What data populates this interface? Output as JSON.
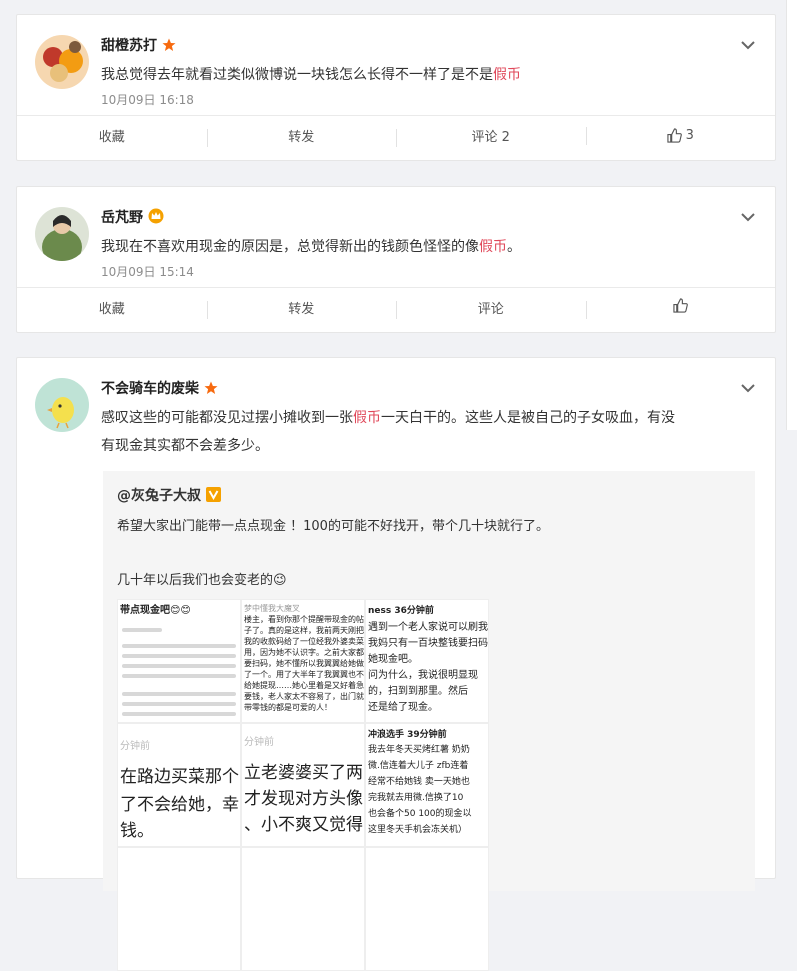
{
  "posts": [
    {
      "username": "甜橙苏打",
      "content_before": "我总觉得去年就看过类似微博说一块钱怎么长得不一样了是不是",
      "content_highlight": "假币",
      "content_after": "",
      "time": "10月09日 16:18",
      "actions": {
        "favorite": "收藏",
        "repost": "转发",
        "comment": "评论 2",
        "like_count": "3"
      }
    },
    {
      "username": "岳芃野",
      "content_before": "我现在不喜欢用现金的原因是，总觉得新出的钱颜色怪怪的像",
      "content_highlight": "假币",
      "content_after": "。",
      "time": "10月09日 15:14",
      "actions": {
        "favorite": "收藏",
        "repost": "转发",
        "comment": "评论",
        "like_count": ""
      }
    },
    {
      "username": "不会骑车的废柴",
      "content_line1_before": "感叹这些的可能都没见过摆小摊收到一张",
      "content_highlight": "假币",
      "content_line1_after": "一天白干的。这些人是被自己的子女吸血，有没",
      "content_line2": "有现金其实都不会差多少。",
      "retweet": {
        "author": "@灰兔子大叔",
        "text1": "希望大家出门能带一点点现金 ！100的可能不好找开，带个几十块就行了。",
        "text2": "几十年以后我们也会变老的😉"
      },
      "thumbs": [
        {
          "title": "带点现金吧😊😊",
          "lines": []
        },
        {
          "title": "梦中懂我大魔叉",
          "lines": [
            "楼主，看到你那个提醒带现金的帖",
            "子了。真的是这样，我前两天刚把",
            "我的收款码给了一位经我外婆卖菜",
            "用，因为她不认识字。之前大家都",
            "要扫码，她不懂所以我翼翼给她做",
            "了一个。用了大半年了我翼翼也不",
            "给她提现……她心里着是又好着急",
            "要钱，老人家太不容易了，出门就",
            "带零钱的都是可爱的人！"
          ]
        },
        {
          "title": "ness 36分钟前",
          "lines": [
            "遇到一个老人家说可以刷我",
            "我妈只有一百块整钱要扫码",
            "她现金吧。"
          ]
        },
        {
          "title": "分钟前",
          "lines": [
            "在路边买菜那个",
            "了不会给她，幸",
            "钱。"
          ]
        },
        {
          "title": "分钟前",
          "lines": [
            "立老婆婆买了两",
            "才发现对方头像",
            "、小不爽又觉得"
          ]
        },
        {
          "title": "冲浪选手 39分钟前",
          "lines": [
            "我去年冬天买烤红薯 奶奶",
            "微.信连着大儿子 zfb连着",
            "经常不给她钱 卖一天她也",
            "完我就去用微.信换了10",
            "也会备个50 100的现金以",
            "这里冬天手机会冻关机）"
          ]
        },
        {
          "title": "问为什么，我说很明显现",
          "lines": [
            "的，扫到到那里。然后",
            "还是给了现金。"
          ]
        }
      ]
    }
  ],
  "colors": {
    "highlight": "#e0485a",
    "background": "#f1f2f5",
    "badge_orange": "#f76a0f",
    "vip_gold": "#f5a100"
  }
}
